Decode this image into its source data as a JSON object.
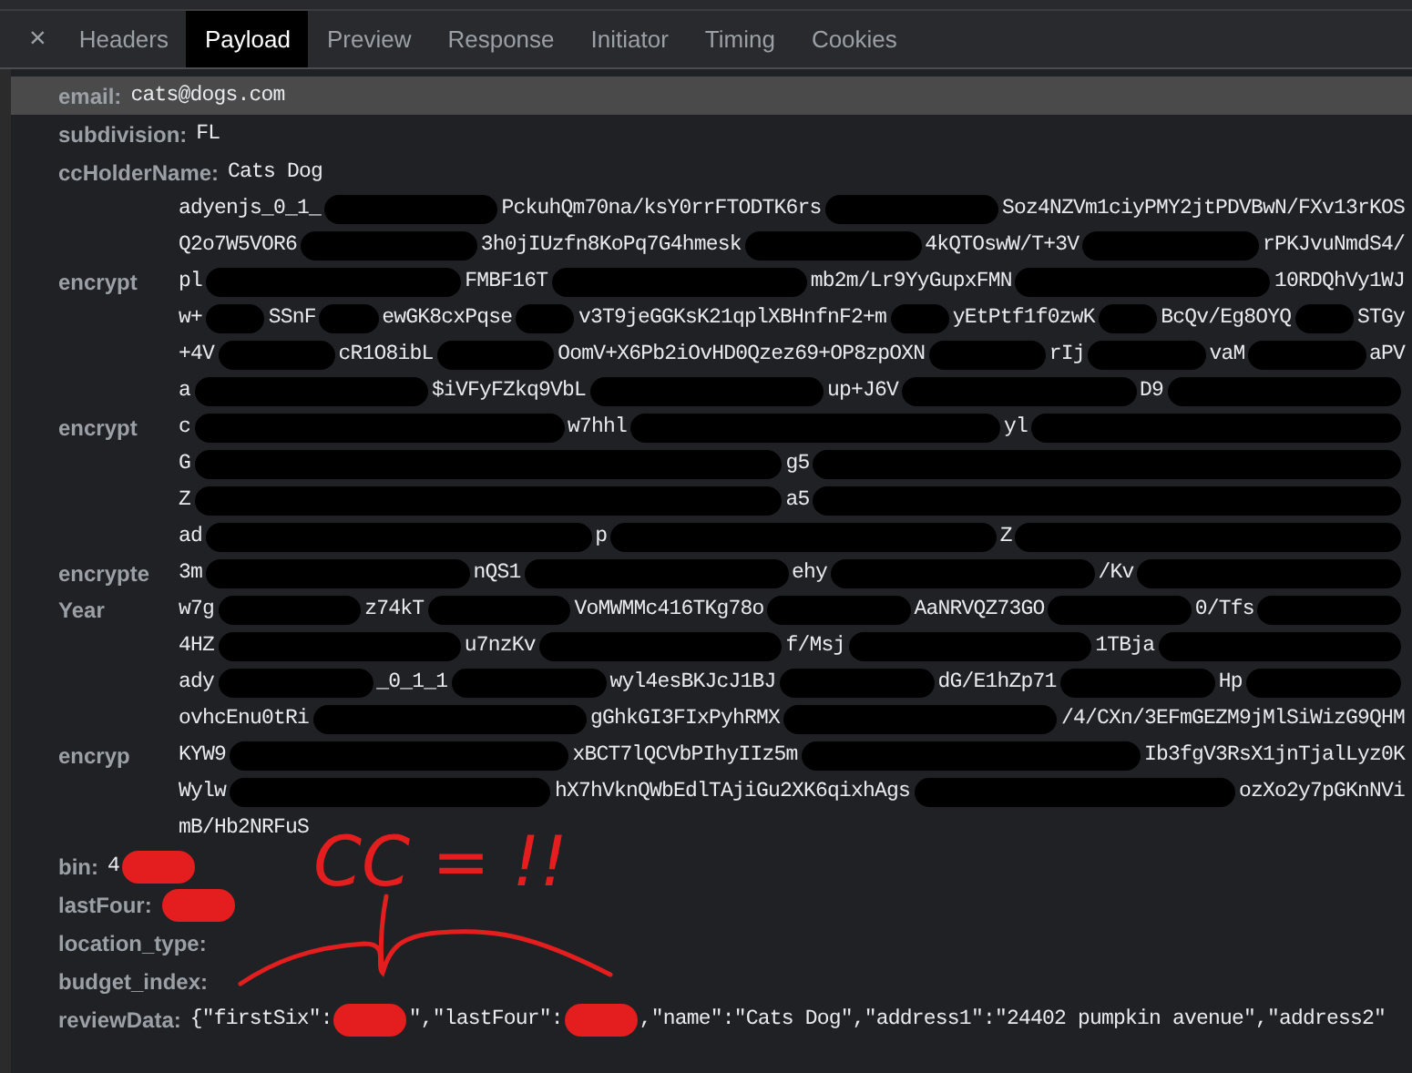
{
  "tabs": [
    {
      "label": "Headers",
      "selected": false
    },
    {
      "label": "Payload",
      "selected": true
    },
    {
      "label": "Preview",
      "selected": false
    },
    {
      "label": "Response",
      "selected": false
    },
    {
      "label": "Initiator",
      "selected": false
    },
    {
      "label": "Timing",
      "selected": false
    },
    {
      "label": "Cookies",
      "selected": false
    }
  ],
  "close_glyph": "×",
  "rows": [
    {
      "kind": "field",
      "label": "email:",
      "selected": true,
      "parts": [
        {
          "kind": "text",
          "text": "cats@dogs.com"
        }
      ]
    },
    {
      "kind": "field",
      "label": "subdivision:",
      "selected": false,
      "parts": [
        {
          "kind": "text",
          "text": "FL"
        }
      ]
    },
    {
      "kind": "field",
      "label": "ccHolderName:",
      "selected": false,
      "parts": [
        {
          "kind": "text",
          "text": "Cats Dog"
        }
      ]
    },
    {
      "kind": "line",
      "parts": [
        {
          "kind": "text",
          "text": "adyenjs_0_1_"
        },
        {
          "kind": "scribble"
        },
        {
          "kind": "text",
          "text": "PckuhQm70na/ksY0rrFTODTK6rs"
        },
        {
          "kind": "scribble"
        },
        {
          "kind": "text",
          "text": "Soz4NZVm1ciyPMY2jtPDVBwN/FXv13rKOS"
        }
      ]
    },
    {
      "kind": "line",
      "parts": [
        {
          "kind": "text",
          "text": "Q2o7W5VOR6"
        },
        {
          "kind": "scribble"
        },
        {
          "kind": "text",
          "text": "3h0jIUzfn8KoPq7G4hmesk"
        },
        {
          "kind": "scribble"
        },
        {
          "kind": "text",
          "text": "4kQTOswW/T+3V"
        },
        {
          "kind": "scribble"
        },
        {
          "kind": "text",
          "text": "rPKJvuNmdS4/"
        }
      ]
    },
    {
      "kind": "line",
      "label": "encrypt",
      "parts": [
        {
          "kind": "text",
          "text": "pl"
        },
        {
          "kind": "scribble"
        },
        {
          "kind": "text",
          "text": "FMBF16T"
        },
        {
          "kind": "scribble"
        },
        {
          "kind": "text",
          "text": "mb2m/Lr9YyGupxFMN"
        },
        {
          "kind": "scribble"
        },
        {
          "kind": "text",
          "text": "10RDQhVy1WJ"
        }
      ]
    },
    {
      "kind": "line",
      "parts": [
        {
          "kind": "text",
          "text": "w+"
        },
        {
          "kind": "scribble"
        },
        {
          "kind": "text",
          "text": "SSnF"
        },
        {
          "kind": "scribble"
        },
        {
          "kind": "text",
          "text": "ewGK8cxPqse"
        },
        {
          "kind": "scribble"
        },
        {
          "kind": "text",
          "text": "v3T9jeGGKsK21qplXBHnfnF2+m"
        },
        {
          "kind": "scribble"
        },
        {
          "kind": "text",
          "text": "yEtPtf1f0zwK"
        },
        {
          "kind": "scribble"
        },
        {
          "kind": "text",
          "text": "BcQv/Eg8OYQ"
        },
        {
          "kind": "scribble"
        },
        {
          "kind": "text",
          "text": "STGy"
        }
      ]
    },
    {
      "kind": "line",
      "parts": [
        {
          "kind": "text",
          "text": "+4V"
        },
        {
          "kind": "scribble"
        },
        {
          "kind": "text",
          "text": "cR1O8ibL"
        },
        {
          "kind": "scribble"
        },
        {
          "kind": "text",
          "text": "OomV+X6Pb2iOvHD0Qzez69+OP8zpOXN"
        },
        {
          "kind": "scribble"
        },
        {
          "kind": "text",
          "text": "rIj"
        },
        {
          "kind": "scribble"
        },
        {
          "kind": "text",
          "text": "vaM"
        },
        {
          "kind": "scribble"
        },
        {
          "kind": "text",
          "text": "aPV"
        }
      ]
    },
    {
      "kind": "line",
      "parts": [
        {
          "kind": "text",
          "text": "a"
        },
        {
          "kind": "scribble"
        },
        {
          "kind": "text",
          "text": "$iVFyFZkq9VbL"
        },
        {
          "kind": "scribble"
        },
        {
          "kind": "text",
          "text": "up+J6V"
        },
        {
          "kind": "scribble"
        },
        {
          "kind": "text",
          "text": "D9"
        },
        {
          "kind": "scribble"
        }
      ]
    },
    {
      "kind": "line",
      "label": "encrypt",
      "parts": [
        {
          "kind": "text",
          "text": "c"
        },
        {
          "kind": "scribble"
        },
        {
          "kind": "text",
          "text": "w7hhl"
        },
        {
          "kind": "scribble"
        },
        {
          "kind": "text",
          "text": "yl"
        },
        {
          "kind": "scribble"
        }
      ]
    },
    {
      "kind": "line",
      "parts": [
        {
          "kind": "text",
          "text": "G"
        },
        {
          "kind": "scribble"
        },
        {
          "kind": "text",
          "text": "g5"
        },
        {
          "kind": "scribble"
        }
      ]
    },
    {
      "kind": "line",
      "parts": [
        {
          "kind": "text",
          "text": "Z"
        },
        {
          "kind": "scribble"
        },
        {
          "kind": "text",
          "text": "a5"
        },
        {
          "kind": "scribble"
        }
      ]
    },
    {
      "kind": "line",
      "parts": [
        {
          "kind": "text",
          "text": "ad"
        },
        {
          "kind": "scribble"
        },
        {
          "kind": "text",
          "text": "p"
        },
        {
          "kind": "scribble"
        },
        {
          "kind": "text",
          "text": "Z"
        },
        {
          "kind": "scribble"
        }
      ]
    },
    {
      "kind": "line",
      "label": "encrypte",
      "parts": [
        {
          "kind": "text",
          "text": "3m"
        },
        {
          "kind": "scribble"
        },
        {
          "kind": "text",
          "text": "nQS1"
        },
        {
          "kind": "scribble"
        },
        {
          "kind": "text",
          "text": "ehy"
        },
        {
          "kind": "scribble"
        },
        {
          "kind": "text",
          "text": "/Kv"
        },
        {
          "kind": "scribble"
        }
      ]
    },
    {
      "kind": "line",
      "label": "Year",
      "parts": [
        {
          "kind": "text",
          "text": "w7g"
        },
        {
          "kind": "scribble"
        },
        {
          "kind": "text",
          "text": "z74kT"
        },
        {
          "kind": "scribble"
        },
        {
          "kind": "text",
          "text": "VoMWMMc416TKg78o"
        },
        {
          "kind": "scribble"
        },
        {
          "kind": "text",
          "text": "AaNRVQZ73GO"
        },
        {
          "kind": "scribble"
        },
        {
          "kind": "text",
          "text": "0/Tfs"
        },
        {
          "kind": "scribble"
        }
      ]
    },
    {
      "kind": "line",
      "parts": [
        {
          "kind": "text",
          "text": "4HZ"
        },
        {
          "kind": "scribble"
        },
        {
          "kind": "text",
          "text": "u7nzKv"
        },
        {
          "kind": "scribble"
        },
        {
          "kind": "text",
          "text": "f/Msj"
        },
        {
          "kind": "scribble"
        },
        {
          "kind": "text",
          "text": "1TBja"
        },
        {
          "kind": "scribble"
        }
      ]
    },
    {
      "kind": "line",
      "parts": [
        {
          "kind": "text",
          "text": "ady"
        },
        {
          "kind": "scribble"
        },
        {
          "kind": "text",
          "text": "_0_1_1"
        },
        {
          "kind": "scribble"
        },
        {
          "kind": "text",
          "text": "wyl4esBKJcJ1BJ"
        },
        {
          "kind": "scribble"
        },
        {
          "kind": "text",
          "text": "dG/E1hZp71"
        },
        {
          "kind": "scribble"
        },
        {
          "kind": "text",
          "text": "Hp"
        },
        {
          "kind": "scribble"
        }
      ]
    },
    {
      "kind": "line",
      "parts": [
        {
          "kind": "text",
          "text": "ovhcEnu0tRi"
        },
        {
          "kind": "scribble"
        },
        {
          "kind": "text",
          "text": "gGhkGI3FIxPyhRMX"
        },
        {
          "kind": "scribble"
        },
        {
          "kind": "text",
          "text": "/4/CXn/3EFmGEZM9jMlSiWizG9QHM"
        }
      ]
    },
    {
      "kind": "line",
      "label": "encryp",
      "parts": [
        {
          "kind": "text",
          "text": "KYW9"
        },
        {
          "kind": "scribble"
        },
        {
          "kind": "text",
          "text": "xBCT7lQCVbPIhyIIz5m"
        },
        {
          "kind": "scribble"
        },
        {
          "kind": "text",
          "text": "Ib3fgV3RsX1jnTjalLyz0K"
        }
      ]
    },
    {
      "kind": "line",
      "parts": [
        {
          "kind": "text",
          "text": "Wylw"
        },
        {
          "kind": "scribble"
        },
        {
          "kind": "text",
          "text": "hX7hVknQWbEdlTAjiGu2XK6qixhAgs"
        },
        {
          "kind": "scribble"
        },
        {
          "kind": "text",
          "text": "ozXo2y7pGKnNVi"
        }
      ]
    },
    {
      "kind": "line",
      "parts": [
        {
          "kind": "text",
          "text": "mB/Hb"
        },
        {
          "kind": "text",
          "text": "2NRFuS"
        }
      ]
    },
    {
      "kind": "field",
      "label": "bin:",
      "selected": false,
      "parts": [
        {
          "kind": "text",
          "text": "4"
        },
        {
          "kind": "marker"
        }
      ]
    },
    {
      "kind": "field",
      "label": "lastFour:",
      "selected": false,
      "parts": [
        {
          "kind": "marker"
        }
      ]
    },
    {
      "kind": "field",
      "label": "location_type:",
      "selected": false,
      "parts": []
    },
    {
      "kind": "field",
      "label": "budget_index:",
      "selected": false,
      "parts": []
    },
    {
      "kind": "field",
      "label": "reviewData:",
      "selected": false,
      "parts": [
        {
          "kind": "text",
          "text": "{\"firstSix\":"
        },
        {
          "kind": "marker"
        },
        {
          "kind": "text",
          "text": "\",\"lastFour\":"
        },
        {
          "kind": "marker"
        },
        {
          "kind": "text",
          "text": ",\"name\":\"Cats Dog\",\"address1\":\"24402 pumpkin avenue\",\"address2\""
        }
      ]
    }
  ],
  "annotation": {
    "text": "CC = !!"
  }
}
